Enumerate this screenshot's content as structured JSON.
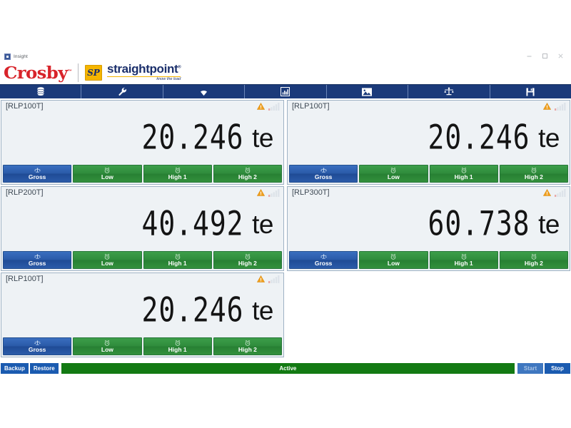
{
  "window": {
    "title": "Insight",
    "controls": {
      "minimize": "minimize",
      "maximize": "maximize",
      "close": "close"
    }
  },
  "brand": {
    "crosby": "Crosby",
    "crosby_tm": "™",
    "sp_badge": "SP",
    "straightpoint": "straightpoint",
    "straightpoint_reg": "®",
    "tagline": "know the load"
  },
  "toolbar": {
    "items": [
      {
        "icon": "database-icon",
        "name": "tool-database"
      },
      {
        "icon": "wrench-icon",
        "name": "tool-settings"
      },
      {
        "icon": "wifi-icon",
        "name": "tool-wireless"
      },
      {
        "icon": "bar-chart-icon",
        "name": "tool-chart"
      },
      {
        "icon": "image-icon",
        "name": "tool-image"
      },
      {
        "icon": "scales-icon",
        "name": "tool-calibration"
      },
      {
        "icon": "save-icon",
        "name": "tool-save"
      }
    ]
  },
  "panels": [
    {
      "tag": "[RLP100T]",
      "value": "20.246",
      "unit": "te",
      "warning": true,
      "signal_bars": 0,
      "buttons": [
        {
          "label": "Gross",
          "icon": "scales-icon",
          "color": "blue"
        },
        {
          "label": "Low",
          "icon": "alarm-icon",
          "color": "green"
        },
        {
          "label": "High 1",
          "icon": "alarm-icon",
          "color": "green"
        },
        {
          "label": "High 2",
          "icon": "alarm-icon",
          "color": "green"
        }
      ]
    },
    {
      "tag": "[RLP100T]",
      "value": "20.246",
      "unit": "te",
      "warning": true,
      "signal_bars": 0,
      "buttons": [
        {
          "label": "Gross",
          "icon": "scales-icon",
          "color": "blue"
        },
        {
          "label": "Low",
          "icon": "alarm-icon",
          "color": "green"
        },
        {
          "label": "High 1",
          "icon": "alarm-icon",
          "color": "green"
        },
        {
          "label": "High 2",
          "icon": "alarm-icon",
          "color": "green"
        }
      ]
    },
    {
      "tag": "[RLP200T]",
      "value": "40.492",
      "unit": "te",
      "warning": true,
      "signal_bars": 0,
      "buttons": [
        {
          "label": "Gross",
          "icon": "scales-icon",
          "color": "blue"
        },
        {
          "label": "Low",
          "icon": "alarm-icon",
          "color": "green"
        },
        {
          "label": "High 1",
          "icon": "alarm-icon",
          "color": "green"
        },
        {
          "label": "High 2",
          "icon": "alarm-icon",
          "color": "green"
        }
      ]
    },
    {
      "tag": "[RLP300T]",
      "value": "60.738",
      "unit": "te",
      "warning": true,
      "signal_bars": 0,
      "buttons": [
        {
          "label": "Gross",
          "icon": "scales-icon",
          "color": "blue"
        },
        {
          "label": "Low",
          "icon": "alarm-icon",
          "color": "green"
        },
        {
          "label": "High 1",
          "icon": "alarm-icon",
          "color": "green"
        },
        {
          "label": "High 2",
          "icon": "alarm-icon",
          "color": "green"
        }
      ]
    },
    {
      "tag": "[RLP100T]",
      "value": "20.246",
      "unit": "te",
      "warning": true,
      "signal_bars": 0,
      "buttons": [
        {
          "label": "Gross",
          "icon": "scales-icon",
          "color": "blue"
        },
        {
          "label": "Low",
          "icon": "alarm-icon",
          "color": "green"
        },
        {
          "label": "High 1",
          "icon": "alarm-icon",
          "color": "green"
        },
        {
          "label": "High 2",
          "icon": "alarm-icon",
          "color": "green"
        }
      ]
    }
  ],
  "statusbar": {
    "backup_label": "Backup",
    "restore_label": "Restore",
    "status_text": "Active",
    "start_label": "Start",
    "stop_label": "Stop",
    "start_enabled": false,
    "stop_enabled": true
  },
  "colors": {
    "toolbar_blue": "#1b3a7a",
    "button_blue": "#2a5aa8",
    "button_green": "#2f8c3c",
    "status_green": "#137a13",
    "panel_bg": "#eef2f5",
    "crosby_red": "#d8232a",
    "sp_yellow": "#f5b500",
    "warning_orange": "#f0a020"
  }
}
